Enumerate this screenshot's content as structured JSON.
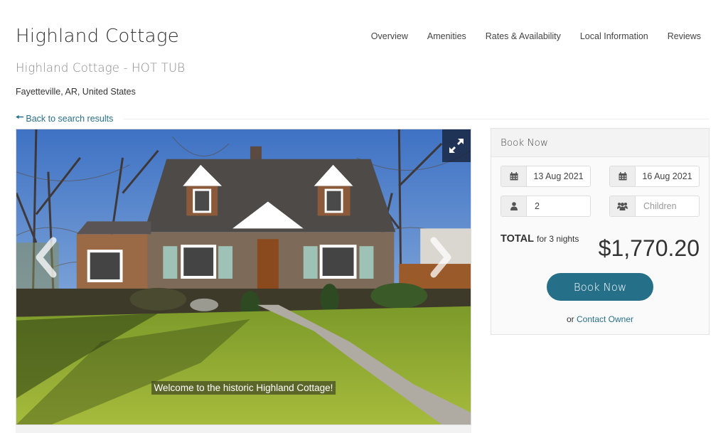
{
  "header": {
    "title": "Highland Cottage",
    "subtitle": "Highland Cottage - HOT TUB",
    "location": "Fayetteville, AR, United States"
  },
  "nav": {
    "items": [
      {
        "label": "Overview"
      },
      {
        "label": "Amenities"
      },
      {
        "label": "Rates & Availability"
      },
      {
        "label": "Local Information"
      },
      {
        "label": "Reviews"
      }
    ]
  },
  "back_link": {
    "icon": "arrow-left-icon",
    "label": "Back to search results"
  },
  "gallery": {
    "caption": "Welcome to the historic Highland Cottage!",
    "expand_icon": "expand-icon",
    "prev_icon": "chevron-left-icon",
    "next_icon": "chevron-right-icon"
  },
  "booking": {
    "heading": "Book Now",
    "checkin": {
      "icon": "calendar-icon",
      "value": "13 Aug 2021"
    },
    "checkout": {
      "icon": "calendar-icon",
      "value": "16 Aug 2021"
    },
    "adults": {
      "icon": "user-icon",
      "value": "2"
    },
    "children": {
      "icon": "users-icon",
      "value": "",
      "placeholder": "Children"
    },
    "total_label": "TOTAL",
    "total_suffix": "for 3 nights",
    "total_amount": "$1,770.20",
    "book_button": "Book Now",
    "contact_prefix": "or",
    "contact_link": "Contact Owner",
    "accent_color": "#256f88"
  }
}
